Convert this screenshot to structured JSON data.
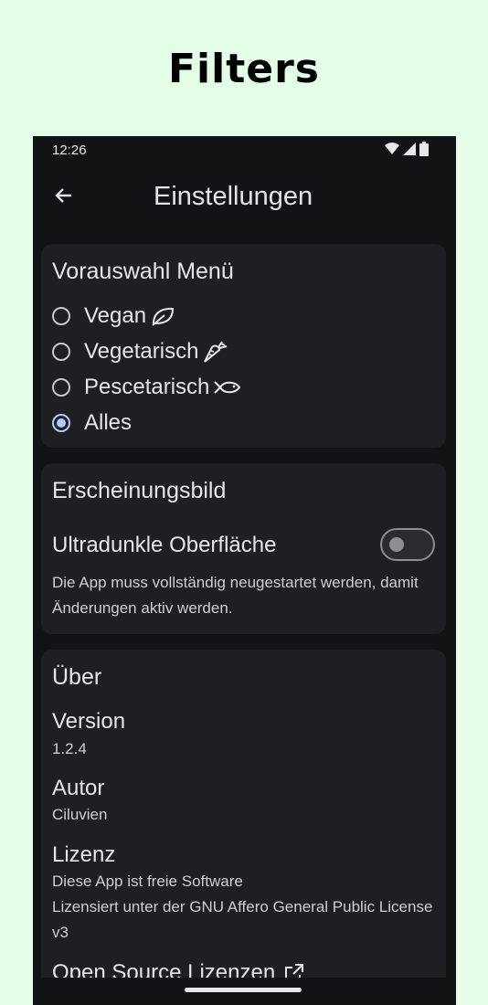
{
  "banner": {
    "title": "Filters"
  },
  "status": {
    "time": "12:26",
    "icons": [
      "wifi-icon",
      "signal-icon",
      "battery-icon"
    ]
  },
  "appbar": {
    "title": "Einstellungen",
    "back_icon": "arrow-back-icon"
  },
  "preselection": {
    "title": "Vorauswahl Menü",
    "options": [
      {
        "label": "Vegan",
        "icon": "leaf-icon",
        "checked": false
      },
      {
        "label": "Vegetarisch",
        "icon": "carrot-icon",
        "checked": false
      },
      {
        "label": "Pescetarisch",
        "icon": "fish-icon",
        "checked": false
      },
      {
        "label": "Alles",
        "icon": "",
        "checked": true
      }
    ]
  },
  "appearance": {
    "title": "Erscheinungsbild",
    "ultradark_label": "Ultradunkle Oberfläche",
    "ultradark_enabled": false,
    "hint": "Die App muss vollständig neugestartet werden, damit Änderungen aktiv werden."
  },
  "about": {
    "title": "Über",
    "version_label": "Version",
    "version_value": "1.2.4",
    "author_label": "Autor",
    "author_value": "Ciluvien",
    "license_label": "Lizenz",
    "license_line1": "Diese App ist freie Software",
    "license_line2": "Lizensiert unter der GNU Affero General Public License v3",
    "oss_label": "Open Source Lizenzen",
    "oss_icon": "open-external-icon"
  },
  "colors": {
    "background": "#e3fde6",
    "phone_bg": "#111315",
    "card_bg": "#1d1f23",
    "accent": "#b8c6ff"
  }
}
